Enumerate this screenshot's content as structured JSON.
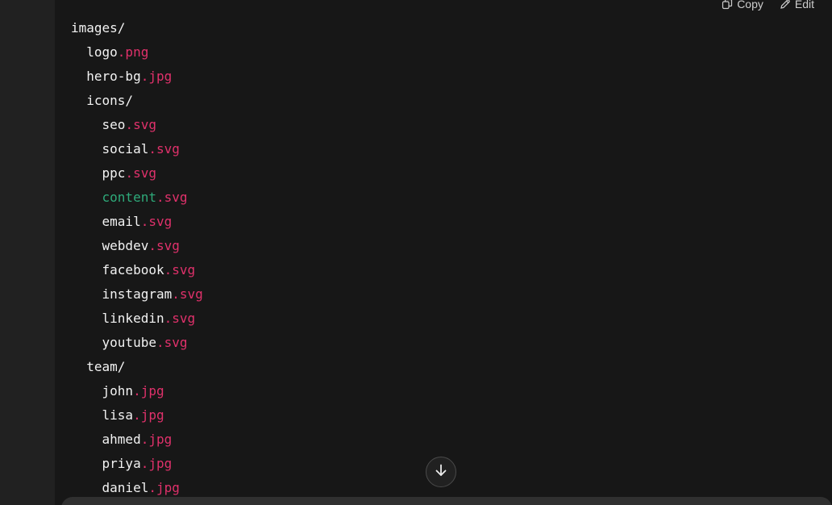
{
  "toolbar": {
    "copy_label": "Copy",
    "edit_label": "Edit"
  },
  "tree": [
    {
      "indent": 0,
      "name": "images/",
      "ext": "",
      "highlight": false
    },
    {
      "indent": 1,
      "name": "logo",
      "ext": ".png",
      "highlight": false
    },
    {
      "indent": 1,
      "name": "hero-bg",
      "ext": ".jpg",
      "highlight": false
    },
    {
      "indent": 1,
      "name": "icons/",
      "ext": "",
      "highlight": false
    },
    {
      "indent": 2,
      "name": "seo",
      "ext": ".svg",
      "highlight": false
    },
    {
      "indent": 2,
      "name": "social",
      "ext": ".svg",
      "highlight": false
    },
    {
      "indent": 2,
      "name": "ppc",
      "ext": ".svg",
      "highlight": false
    },
    {
      "indent": 2,
      "name": "content",
      "ext": ".svg",
      "highlight": true
    },
    {
      "indent": 2,
      "name": "email",
      "ext": ".svg",
      "highlight": false
    },
    {
      "indent": 2,
      "name": "webdev",
      "ext": ".svg",
      "highlight": false
    },
    {
      "indent": 2,
      "name": "facebook",
      "ext": ".svg",
      "highlight": false
    },
    {
      "indent": 2,
      "name": "instagram",
      "ext": ".svg",
      "highlight": false
    },
    {
      "indent": 2,
      "name": "linkedin",
      "ext": ".svg",
      "highlight": false
    },
    {
      "indent": 2,
      "name": "youtube",
      "ext": ".svg",
      "highlight": false
    },
    {
      "indent": 1,
      "name": "team/",
      "ext": "",
      "highlight": false
    },
    {
      "indent": 2,
      "name": "john",
      "ext": ".jpg",
      "highlight": false
    },
    {
      "indent": 2,
      "name": "lisa",
      "ext": ".jpg",
      "highlight": false
    },
    {
      "indent": 2,
      "name": "ahmed",
      "ext": ".jpg",
      "highlight": false
    },
    {
      "indent": 2,
      "name": "priya",
      "ext": ".jpg",
      "highlight": false
    },
    {
      "indent": 2,
      "name": "daniel",
      "ext": ".jpg",
      "highlight": false
    }
  ],
  "icons": {
    "copy": "copy-icon",
    "edit": "pencil-icon",
    "scroll": "arrow-down-icon"
  },
  "colors": {
    "background": "#212121",
    "code_background": "#171717",
    "text": "#f2f2f2",
    "extension": "#e0316b",
    "highlight_name": "#2eaa7a"
  }
}
